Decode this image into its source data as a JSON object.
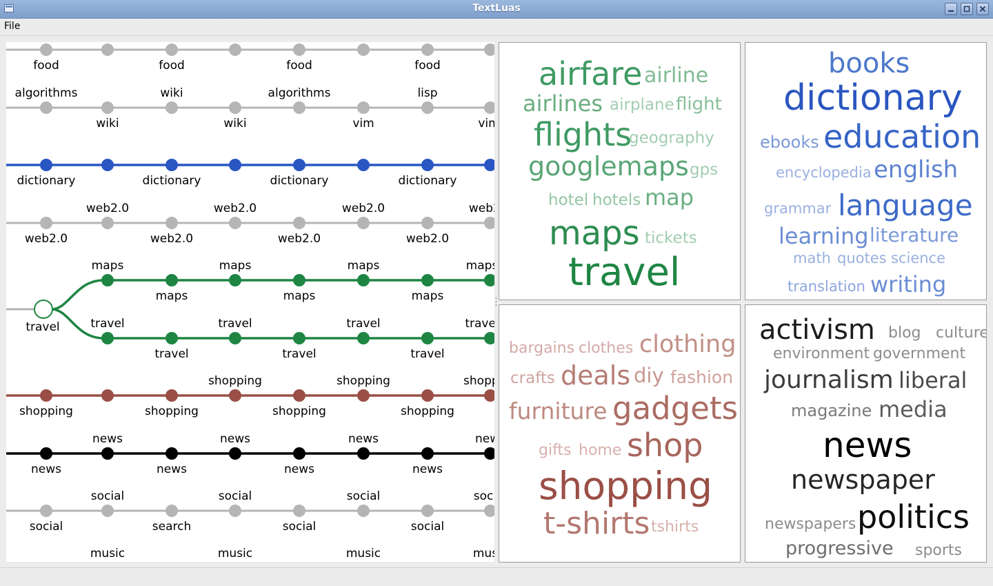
{
  "window": {
    "title": "TextLuas"
  },
  "menu": {
    "file": "File"
  },
  "colors": {
    "grey": "#b5b5b5",
    "blue": "#2956c3",
    "green": "#1e8543",
    "brown": "#9a4f46",
    "black": "#000000"
  },
  "tree": {
    "rows": [
      {
        "id": "food",
        "color": "grey",
        "above": [
          "food",
          "food",
          "food",
          "food"
        ],
        "below": []
      },
      {
        "id": "wiki",
        "color": "grey",
        "above": [
          "algorithms",
          "wiki",
          "algorithms",
          "lisp"
        ],
        "below": [
          "wiki",
          "wiki",
          "vim",
          "vim"
        ]
      },
      {
        "id": "dictionary",
        "color": "blue",
        "above": [],
        "below": [
          "dictionary",
          "dictionary",
          "dictionary",
          "dictionary"
        ]
      },
      {
        "id": "web2",
        "color": "grey",
        "above": [
          "web2.0",
          "web2.0",
          "web2.0",
          "web2.0"
        ],
        "below": [
          "web2.0",
          "web2.0",
          "web2.0",
          "web2.0"
        ]
      },
      {
        "id": "maps",
        "color": "green",
        "above": [
          "maps",
          "maps",
          "maps",
          "maps"
        ],
        "below": [
          "maps",
          "maps",
          "maps"
        ]
      },
      {
        "id": "travel",
        "color": "green",
        "above": [
          "travel",
          "travel",
          "travel",
          "travel"
        ],
        "below": [
          "travel",
          "travel",
          "travel"
        ]
      },
      {
        "id": "shopping",
        "color": "brown",
        "above": [
          "shopping",
          "shopping",
          "shopping"
        ],
        "below": [
          "shopping",
          "shopping",
          "shopping",
          "shopping"
        ]
      },
      {
        "id": "news",
        "color": "black",
        "above": [
          "news",
          "news",
          "news",
          "news"
        ],
        "below": [
          "news",
          "news",
          "news",
          "news"
        ]
      },
      {
        "id": "social",
        "color": "grey",
        "above": [
          "social",
          "social",
          "social",
          "social"
        ],
        "below": [
          "social",
          "search",
          "social",
          "social"
        ]
      },
      {
        "id": "music",
        "color": "grey",
        "above": [
          "music",
          "music",
          "music",
          "music"
        ],
        "below": []
      }
    ],
    "root_label": "travel"
  },
  "clouds": [
    {
      "id": "travel-cloud",
      "words": [
        {
          "t": "airfare",
          "c": "#3f9a63"
        },
        {
          "t": "airline",
          "c": "#80bb93"
        },
        {
          "t": "airlines",
          "c": "#6aae81"
        },
        {
          "t": "airplane",
          "c": "#a3cdb1"
        },
        {
          "t": "flight",
          "c": "#88bf99"
        },
        {
          "t": "flights",
          "c": "#3f9a63"
        },
        {
          "t": "geography",
          "c": "#a3cdb1"
        },
        {
          "t": "googlemaps",
          "c": "#5aa676"
        },
        {
          "t": "gps",
          "c": "#a3cdb1"
        },
        {
          "t": "hotel",
          "c": "#94c5a3"
        },
        {
          "t": "hotels",
          "c": "#94c5a3"
        },
        {
          "t": "map",
          "c": "#6aae81"
        },
        {
          "t": "maps",
          "c": "#2d8c50"
        },
        {
          "t": "tickets",
          "c": "#a3cdb1"
        },
        {
          "t": "travel",
          "c": "#1e8543"
        }
      ]
    },
    {
      "id": "education-cloud",
      "words": [
        {
          "t": "books",
          "c": "#4d78cc"
        },
        {
          "t": "dictionary",
          "c": "#2a56c0"
        },
        {
          "t": "ebooks",
          "c": "#7b99d8"
        },
        {
          "t": "education",
          "c": "#3664c6"
        },
        {
          "t": "encyclopedia",
          "c": "#9ab0e0"
        },
        {
          "t": "english",
          "c": "#5d83d0"
        },
        {
          "t": "grammar",
          "c": "#9ab0e0"
        },
        {
          "t": "language",
          "c": "#3d6ac8"
        },
        {
          "t": "learning",
          "c": "#6b8dd4"
        },
        {
          "t": "literature",
          "c": "#7b99d8"
        },
        {
          "t": "math",
          "c": "#9ab0e0"
        },
        {
          "t": "quotes",
          "c": "#9ab0e0"
        },
        {
          "t": "science",
          "c": "#9ab0e0"
        },
        {
          "t": "translation",
          "c": "#8ea7dd"
        },
        {
          "t": "writing",
          "c": "#6b8dd4"
        }
      ]
    },
    {
      "id": "shopping-cloud",
      "words": [
        {
          "t": "bargains",
          "c": "#d3aaa5"
        },
        {
          "t": "clothes",
          "c": "#d3aaa5"
        },
        {
          "t": "clothing",
          "c": "#c28f88"
        },
        {
          "t": "crafts",
          "c": "#d0a5a0"
        },
        {
          "t": "deals",
          "c": "#b57c74"
        },
        {
          "t": "diy",
          "c": "#c7978f"
        },
        {
          "t": "fashion",
          "c": "#cfa29c"
        },
        {
          "t": "furniture",
          "c": "#bd8880"
        },
        {
          "t": "gadgets",
          "c": "#ab6c63"
        },
        {
          "t": "gifts",
          "c": "#d6b1ac"
        },
        {
          "t": "home",
          "c": "#d6b1ac"
        },
        {
          "t": "shop",
          "c": "#a7655c"
        },
        {
          "t": "shopping",
          "c": "#9a4f46"
        },
        {
          "t": "t-shirts",
          "c": "#b37870"
        },
        {
          "t": "tshirts",
          "c": "#d6b1ac"
        }
      ]
    },
    {
      "id": "news-cloud",
      "words": [
        {
          "t": "activism",
          "c": "#1c1c1c"
        },
        {
          "t": "blog",
          "c": "#8c8c8c"
        },
        {
          "t": "culture",
          "c": "#8c8c8c"
        },
        {
          "t": "environment",
          "c": "#8c8c8c"
        },
        {
          "t": "government",
          "c": "#8c8c8c"
        },
        {
          "t": "journalism",
          "c": "#3c3c3c"
        },
        {
          "t": "liberal",
          "c": "#4a4a4a"
        },
        {
          "t": "magazine",
          "c": "#7a7a7a"
        },
        {
          "t": "media",
          "c": "#5c5c5c"
        },
        {
          "t": "news",
          "c": "#000000"
        },
        {
          "t": "newspaper",
          "c": "#262626"
        },
        {
          "t": "newspapers",
          "c": "#8c8c8c"
        },
        {
          "t": "politics",
          "c": "#0d0d0d"
        },
        {
          "t": "progressive",
          "c": "#6e6e6e"
        },
        {
          "t": "sports",
          "c": "#8c8c8c"
        }
      ]
    }
  ],
  "status": {
    "text": ""
  }
}
